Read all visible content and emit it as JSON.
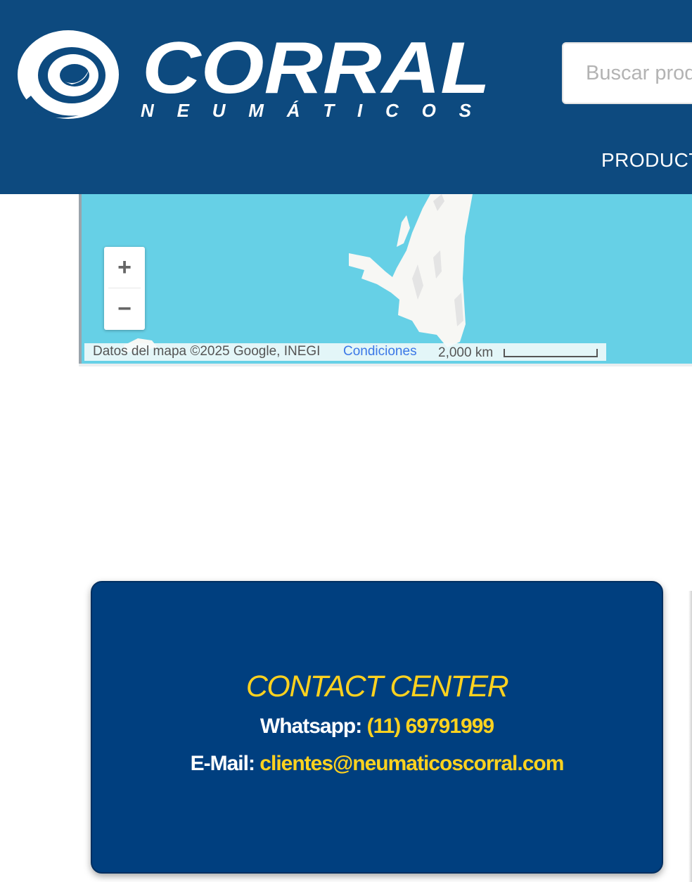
{
  "header": {
    "logo": {
      "brand": "CORRAL",
      "tagline": "NEUMÁTICOS"
    },
    "search": {
      "placeholder": "Buscar productos"
    },
    "nav": {
      "products_label": "PRODUCTOS"
    }
  },
  "map": {
    "zoom_in_label": "+",
    "zoom_out_label": "−",
    "attribution": "Datos del mapa ©2025 Google, INEGI",
    "terms_link": "Condiciones",
    "scale_label": "2,000 km"
  },
  "contact": {
    "title": "CONTACT CENTER",
    "whatsapp_label": "Whatsapp:",
    "whatsapp_value": "(11) 69791999",
    "email_label": "E-Mail:",
    "email_value": "clientes@neumaticoscorral.com"
  },
  "colors": {
    "header_bg": "#0d4a7f",
    "card_bg": "#003f7f",
    "accent_yellow": "#ffd21f",
    "map_water": "#66d0e6",
    "link_blue": "#3b78e7"
  }
}
